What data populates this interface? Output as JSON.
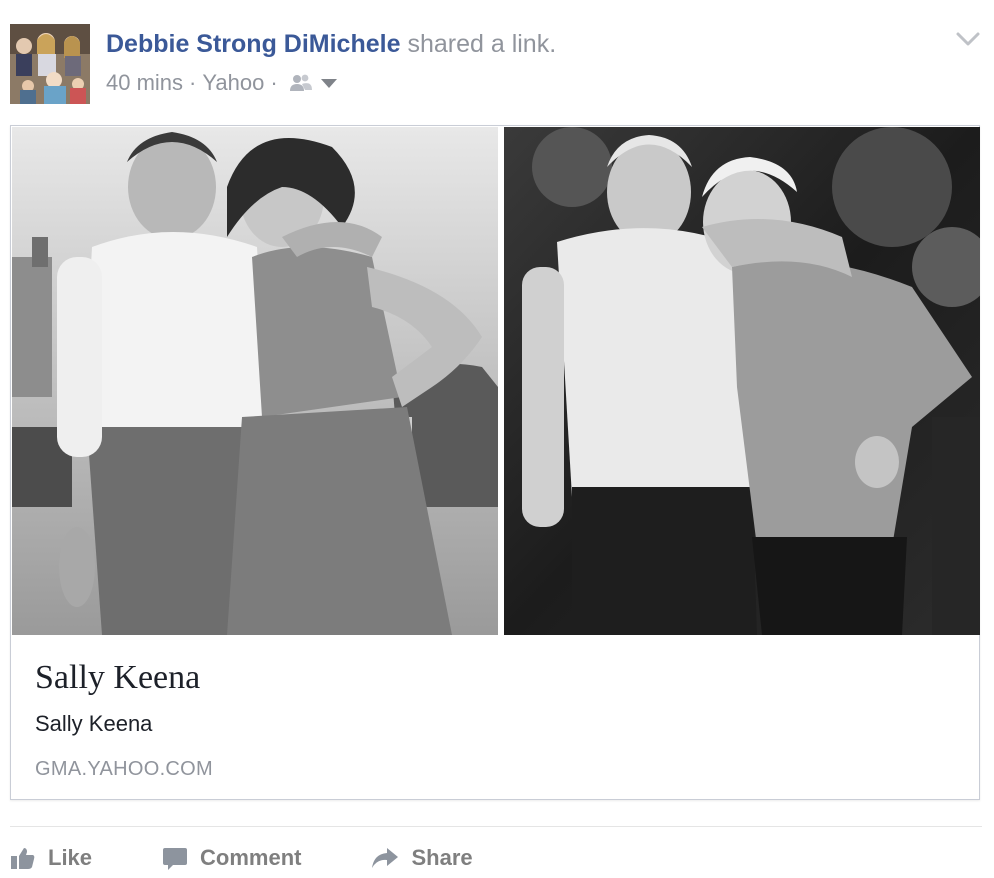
{
  "post": {
    "author": "Debbie Strong DiMichele",
    "action_text": "shared a",
    "action_link": "link.",
    "time": "40 mins",
    "separator": "·",
    "source": "Yahoo",
    "audience_icon": "friends-icon"
  },
  "link_card": {
    "title": "Sally Keena",
    "description": "Sally Keena",
    "domain": "GMA.YAHOO.COM"
  },
  "actions": {
    "like": "Like",
    "comment": "Comment",
    "share": "Share"
  },
  "colors": {
    "author_link": "#3b5998",
    "meta_gray": "#90949c",
    "card_border": "#c9cdd6"
  }
}
